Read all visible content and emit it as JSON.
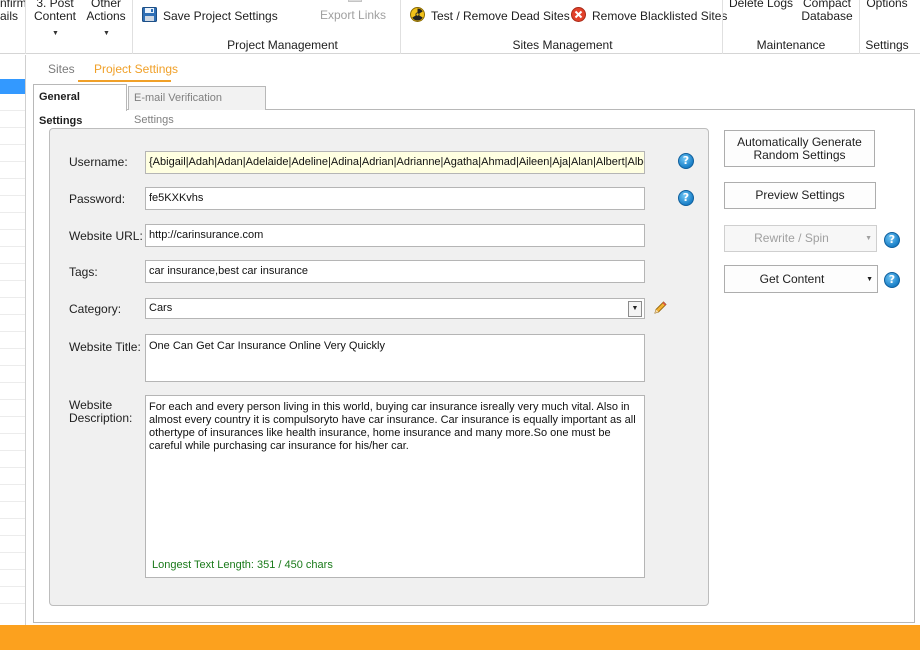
{
  "ribbon": {
    "confirm_emails_top": "nfirm",
    "confirm_emails_bottom": "ails",
    "post_content_top": "3. Post",
    "post_content_bottom": "Content",
    "other_actions_top": "Other",
    "other_actions_bottom": "Actions",
    "save_project": "Save Project Settings",
    "export_links": "Export Links",
    "group_project": "Project Management",
    "test_remove_dead": "Test / Remove Dead Sites",
    "remove_blacklisted": "Remove Blacklisted Sites",
    "group_sites": "Sites Management",
    "delete_logs": "Delete Logs",
    "compact_top": "Compact",
    "compact_bottom": "Database",
    "group_maintenance": "Maintenance",
    "options": "Options",
    "group_settings": "Settings"
  },
  "tabs": {
    "sites": "Sites",
    "project_settings": "Project Settings",
    "general_settings": "General Settings",
    "email_verification": "E-mail Verification Settings"
  },
  "form": {
    "username_label": "Username:",
    "username_value": "{Abigail|Adah|Adan|Adelaide|Adeline|Adina|Adrian|Adrianne|Agatha|Ahmad|Aileen|Aja|Alan|Albert|Albertine|Al",
    "password_label": "Password:",
    "password_value": "fe5KXKvhs",
    "url_label": "Website URL:",
    "url_value": "http://carinsurance.com",
    "tags_label": "Tags:",
    "tags_value": "car insurance,best car insurance",
    "category_label": "Category:",
    "category_value": "Cars",
    "title_label": "Website Title:",
    "title_value": "One Can Get Car Insurance Online Very Quickly",
    "description_label_1": "Website",
    "description_label_2": "Description:",
    "description_value": "For each and every person living in this world, buying car insurance isreally very much vital. Also in almost every country it is compulsoryto have car insurance. Car insurance is equally important as all othertype of insurances like health insurance, home insurance and many more.So one must be careful while purchasing car insurance for his/her car.",
    "length_info": "Longest Text Length: 351 / 450 chars"
  },
  "actions": {
    "auto_generate_1": "Automatically Generate",
    "auto_generate_2": "Random Settings",
    "preview": "Preview Settings",
    "rewrite_spin": "Rewrite / Spin",
    "get_content": "Get Content"
  },
  "icons": {
    "help": "?",
    "dropdown": "▼",
    "edit": "pencil-icon"
  },
  "colors": {
    "accent_orange": "#fca11e",
    "tab_orange": "#f0a028",
    "selection_blue": "#3399ff",
    "success_green": "#1a7a1a"
  }
}
